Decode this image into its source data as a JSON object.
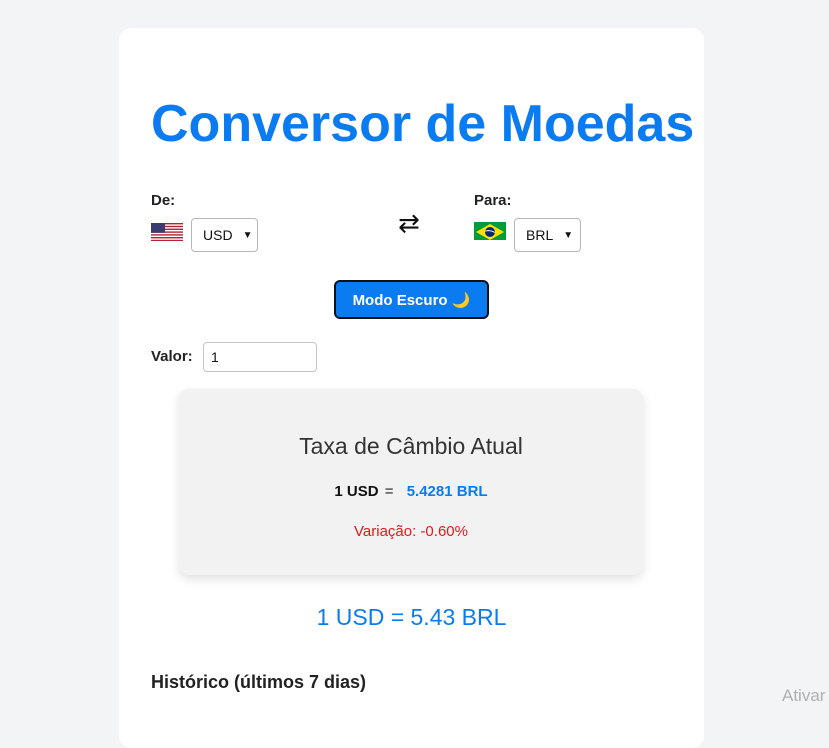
{
  "app": {
    "title": "Conversor de Moedas"
  },
  "converter": {
    "from_label": "De:",
    "from_flag": "us-flag-icon",
    "from_currency": "USD",
    "swap_icon": "swap-arrows-icon",
    "to_label": "Para:",
    "to_flag": "brazil-flag-icon",
    "to_currency": "BRL",
    "dark_mode_label": "Modo Escuro 🌙",
    "amount_label": "Valor:",
    "amount_value": "1"
  },
  "rate_card": {
    "title": "Taxa de Câmbio Atual",
    "base": "1 USD",
    "equals": "=",
    "value": "5.4281 BRL",
    "variation": "Variação: -0.60%"
  },
  "result": {
    "text": "1 USD = 5.43 BRL"
  },
  "history": {
    "title": "Histórico (últimos 7 dias)"
  },
  "overlay": {
    "watermark": "Ativar"
  },
  "colors": {
    "accent": "#0b7bf2",
    "negative": "#e01a1a",
    "page_bg": "#f3f4f6",
    "card_bg": "#ffffff",
    "rate_box_bg": "#f2f2f2"
  }
}
